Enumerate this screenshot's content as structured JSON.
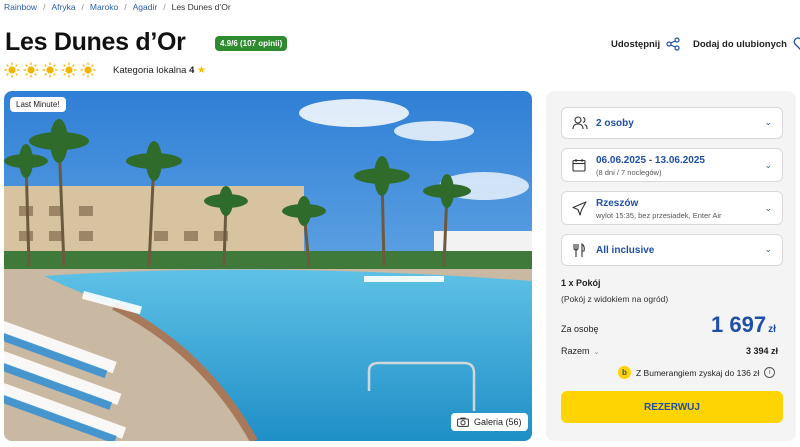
{
  "breadcrumb": [
    "Rainbow",
    "Afryka",
    "Maroko",
    "Agadir",
    "Les Dunes d’Or"
  ],
  "hotel": {
    "name": "Les Dunes d’Or",
    "rating": "4.9/6 (107 opinii)",
    "category_label": "Kategoria lokalna",
    "category_value": "4",
    "suns": 5
  },
  "actions": {
    "share": "Udostępnij",
    "favorite": "Dodaj do ulubionych"
  },
  "hero": {
    "badge": "Last Minute!",
    "gallery": "Galeria (56)"
  },
  "booking": {
    "persons": "2 osoby",
    "dates": "06.06.2025 - 13.06.2025",
    "dates_sub": "(8 dni / 7 noclegów)",
    "departure": "Rzeszów",
    "departure_sub": "wylot 15:35, bez przesiadek, Enter Air",
    "board": "All inclusive",
    "rooms": "1 x Pokój",
    "room_type": "(Pokój z widokiem na ogród)",
    "per_person_label": "Za osobę",
    "price": "1 697",
    "currency": "zł",
    "total_label": "Razem",
    "total": "3 394 zł",
    "promo": "Z Bumerangiem zyskaj do 136 zł",
    "reserve": "REZERWUJ"
  },
  "colors": {
    "accent": "#1e4fa8",
    "rating": "#2e8b2e",
    "cta": "#ffd400"
  }
}
